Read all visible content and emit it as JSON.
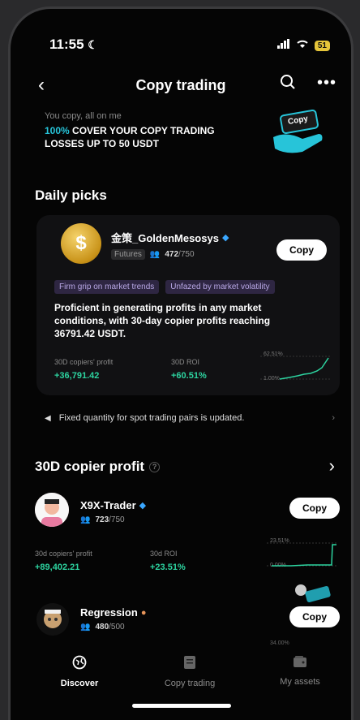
{
  "status_bar": {
    "time": "11:55",
    "battery": "51"
  },
  "nav": {
    "title": "Copy trading"
  },
  "banner": {
    "small_text": "You copy, all on me",
    "accent": "100%",
    "main_line1": " COVER YOUR COPY TRADING",
    "main_line2": "LOSSES UP TO 50 USDT",
    "art_label": "Copy"
  },
  "daily_picks": {
    "title": "Daily picks",
    "trader": {
      "name": "金策_GoldenMesosys",
      "badge": "Futures",
      "copiers": "472",
      "copiers_max": "/750",
      "copy_label": "Copy",
      "tags": [
        "Firm grip on market trends",
        "Unfazed by market volatility"
      ],
      "description": "Proficient in generating profits in any market conditions, with 30-day copier profits reaching 36791.42 USDT.",
      "profit_label": "30D copiers' profit",
      "profit_value": "+36,791.42",
      "roi_label": "30D ROI",
      "roi_value": "+60.51%",
      "chart_high": "62.51%",
      "chart_low": "1.00%"
    }
  },
  "notice": {
    "text": "Fixed quantity for spot trading pairs is updated."
  },
  "copier_profit": {
    "title": "30D copier profit",
    "traders": [
      {
        "name": "X9X-Trader",
        "copiers": "723",
        "copiers_max": "/750",
        "copy_label": "Copy",
        "profit_label": "30d copiers' profit",
        "profit_value": "+89,402.21",
        "roi_label": "30d ROI",
        "roi_value": "+23.51%",
        "chart_high": "23.51%",
        "chart_low": "0.00%"
      },
      {
        "name": "Regression",
        "copiers": "480",
        "copiers_max": "/500",
        "copy_label": "Copy",
        "chart_high": "34.00%"
      }
    ]
  },
  "bottom_nav": {
    "items": [
      {
        "label": "Discover",
        "icon": "globe-icon"
      },
      {
        "label": "Copy trading",
        "icon": "document-icon"
      },
      {
        "label": "My assets",
        "icon": "wallet-icon"
      }
    ]
  },
  "colors": {
    "accent": "#27c4d9",
    "positive": "#2dd4a0",
    "tag_bg": "#2e2642"
  }
}
